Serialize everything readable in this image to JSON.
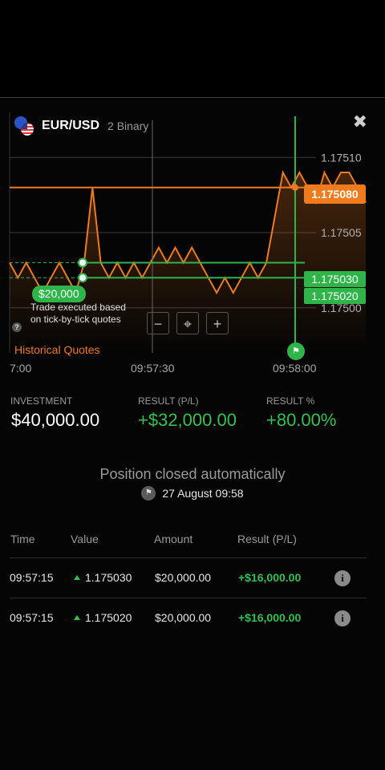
{
  "header": {
    "pair": "EUR/USD",
    "subtitle": "2 Binary",
    "close_icon": "close-icon"
  },
  "chart_data": {
    "type": "line",
    "ylim": [
      1.17497,
      1.17513
    ],
    "y_ticks": [
      "1.17510",
      "1.17505",
      "1.17500"
    ],
    "x_ticks": [
      "7:00",
      "09:57:30",
      "09:58:00"
    ],
    "series": [
      {
        "values": [
          1.17503,
          1.17502,
          1.17503,
          1.17502,
          1.17501,
          1.17502,
          1.17503,
          1.17502,
          1.17501,
          1.17503,
          1.17508,
          1.17503,
          1.17502,
          1.17503,
          1.17502,
          1.17503,
          1.17502,
          1.17503,
          1.17504,
          1.17503,
          1.17504,
          1.17503,
          1.17504,
          1.17503,
          1.17502,
          1.17501,
          1.17502,
          1.17501,
          1.17502,
          1.17503,
          1.17502,
          1.17503,
          1.17506,
          1.17509,
          1.17508,
          1.17509,
          1.17508,
          1.17507,
          1.17509,
          1.17508,
          1.17509,
          1.17509,
          1.17508,
          1.17507
        ]
      }
    ],
    "current_price": "1.175080",
    "strike_levels": [
      "1.175030",
      "1.175020"
    ],
    "colors": {
      "line": "#f07a1e",
      "strike": "#2fb44a"
    }
  },
  "chart_ui": {
    "position_label": "$20,000",
    "trade_note": "Trade executed based on tick-by-tick quotes",
    "historical": "Historical Quotes",
    "zoom_out": "−",
    "center": "⌖",
    "zoom_in": "+"
  },
  "stats": {
    "investment_label": "INVESTMENT",
    "investment": "$40,000.00",
    "pl_label": "RESULT (P/L)",
    "pl": "+$32,000.00",
    "pct_label": "RESULT %",
    "pct": "+80.00%"
  },
  "closed": {
    "message": "Position closed automatically",
    "date": "27 August 09:58"
  },
  "table": {
    "headers": [
      "Time",
      "Value",
      "Amount",
      "Result (P/L)"
    ],
    "rows": [
      {
        "time": "09:57:15",
        "value": "1.175030",
        "amount": "$20,000.00",
        "result": "+$16,000.00"
      },
      {
        "time": "09:57:15",
        "value": "1.175020",
        "amount": "$20,000.00",
        "result": "+$16,000.00"
      }
    ]
  }
}
